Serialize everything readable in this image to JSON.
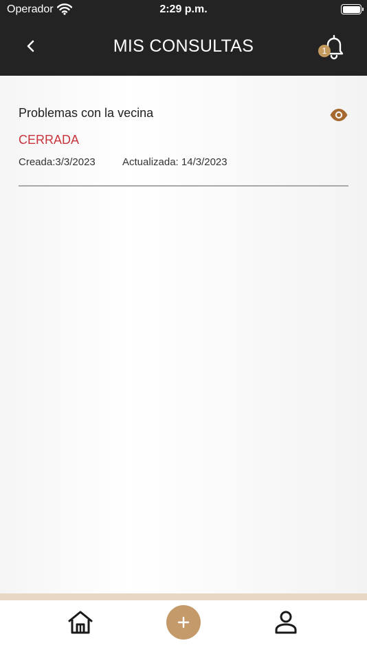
{
  "status_bar": {
    "carrier": "Operador",
    "time": "2:29 p.m.",
    "icons": [
      "wifi-icon",
      "battery-icon"
    ]
  },
  "header": {
    "title": "MIS CONSULTAS",
    "back_icon": "chevron-left-icon",
    "notifications_icon": "bell-icon",
    "notification_count": "1"
  },
  "consultas": [
    {
      "title": "Problemas con la vecina",
      "status": "CERRADA",
      "created": "Creada:3/3/2023",
      "updated": "Actualizada: 14/3/2023",
      "view_icon": "eye-icon"
    }
  ],
  "tab_bar": {
    "items": [
      "home-icon",
      "plus-icon",
      "user-icon"
    ]
  },
  "colors": {
    "header_bg": "#232323",
    "accent": "#c59a6a",
    "status_closed": "#c7343d",
    "eye": "#a6682f"
  }
}
